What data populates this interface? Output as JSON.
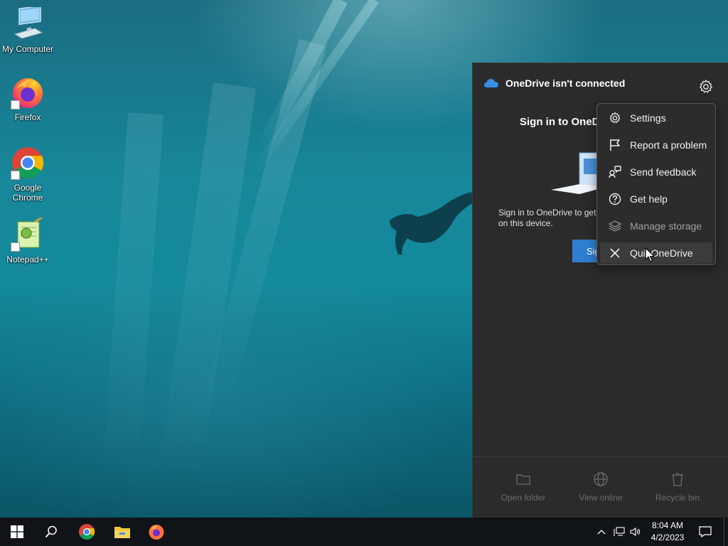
{
  "desktop": {
    "icons": [
      {
        "label": "My Computer",
        "icon": "computer-icon"
      },
      {
        "label": "Firefox",
        "icon": "firefox-icon"
      },
      {
        "label": "Google Chrome",
        "icon": "chrome-icon"
      },
      {
        "label": "Notepad++",
        "icon": "notepadpp-icon"
      }
    ]
  },
  "onedrive": {
    "title": "OneDrive isn't connected",
    "signin_title": "Sign in to OneD",
    "description": "Sign in to OneDrive to get on this device.",
    "signin_button": "Sig",
    "footer": {
      "open_folder": "Open folder",
      "view_online": "View online",
      "recycle_bin": "Recycle bin"
    },
    "menu": [
      {
        "label": "Settings",
        "icon": "gear-icon",
        "enabled": true
      },
      {
        "label": "Report a problem",
        "icon": "flag-icon",
        "enabled": true
      },
      {
        "label": "Send feedback",
        "icon": "feedback-icon",
        "enabled": true
      },
      {
        "label": "Get help",
        "icon": "help-icon",
        "enabled": true
      },
      {
        "label": "Manage storage",
        "icon": "storage-icon",
        "enabled": false
      },
      {
        "label": "Quit OneDrive",
        "icon": "close-icon",
        "enabled": true,
        "hovered": true
      }
    ],
    "colors": {
      "panel": "#2b2b2b",
      "accent": "#2f7fd1"
    }
  },
  "taskbar": {
    "pinned": [
      "start-icon",
      "search-icon",
      "chrome-icon",
      "file-explorer-icon",
      "firefox-icon"
    ],
    "clock": {
      "time": "8:04 AM",
      "date": "4/2/2023"
    }
  }
}
